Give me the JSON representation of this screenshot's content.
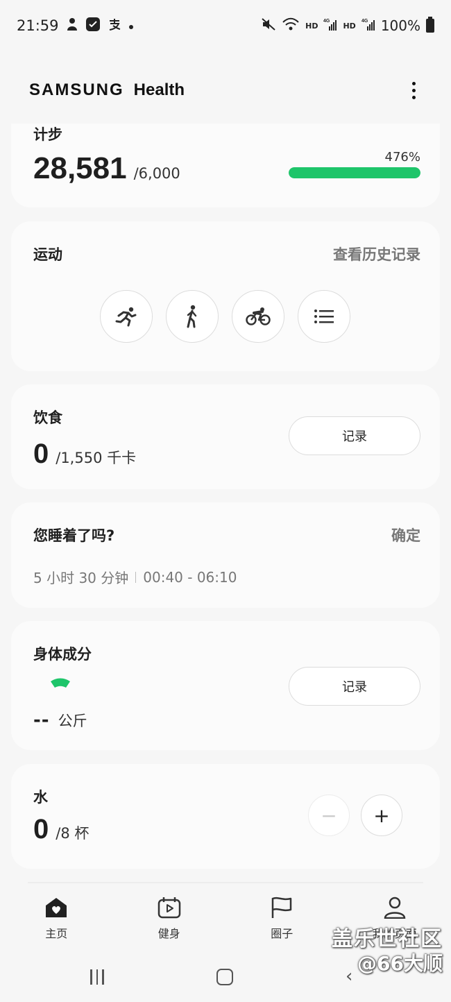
{
  "status_bar": {
    "time": "21:59",
    "left_icons": [
      "person-icon",
      "check-square-icon",
      "alipay-icon",
      "dot-icon"
    ],
    "battery": "100%",
    "network_labels": [
      "HD",
      "4G",
      "HD",
      "4G"
    ]
  },
  "app": {
    "brand_part1": "SAMSUNG",
    "brand_part2": "Health"
  },
  "steps": {
    "title": "计步",
    "value": "28,581",
    "goal": "/6,000",
    "percent_label": "476%",
    "progress_fraction": 1.0,
    "progress_color": "#1ec56a"
  },
  "exercise": {
    "title": "运动",
    "history_link": "查看历史记录",
    "buttons": [
      "running-icon",
      "walking-icon",
      "cycling-icon",
      "list-icon"
    ]
  },
  "food": {
    "title": "饮食",
    "value": "0",
    "goal": "/1,550 千卡",
    "button": "记录"
  },
  "sleep": {
    "title": "您睡着了吗?",
    "confirm": "确定",
    "duration": "5 小时 30 分钟",
    "range": "00:40 - 06:10"
  },
  "body_composition": {
    "title": "身体成分",
    "value": "--",
    "unit": "公斤",
    "button": "记录"
  },
  "water": {
    "title": "水",
    "value": "0",
    "goal": "/8 杯",
    "minus": "−",
    "plus": "+"
  },
  "bottom_nav": {
    "items": [
      {
        "label": "主页",
        "icon": "home-heart-icon"
      },
      {
        "label": "健身",
        "icon": "calendar-play-icon"
      },
      {
        "label": "圈子",
        "icon": "flag-icon"
      },
      {
        "label": "我的页面",
        "icon": "person-icon"
      }
    ]
  },
  "watermark": {
    "line1": "盖乐世社区",
    "line2": "@66大顺"
  }
}
